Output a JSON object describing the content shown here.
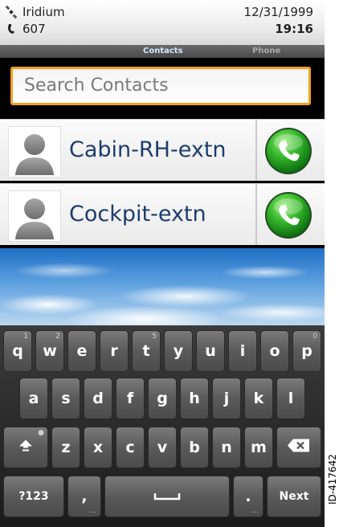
{
  "status_bar": {
    "carrier": "Iridium",
    "line_number": "607",
    "date": "12/31/1999",
    "time": "19:16",
    "icons": [
      "satellite-icon",
      "handset-icon"
    ]
  },
  "tabs": [
    {
      "label": "Contacts",
      "active": true
    },
    {
      "label": "Phone",
      "active": false
    }
  ],
  "search": {
    "placeholder": "Search Contacts",
    "value": ""
  },
  "contacts": [
    {
      "name": "Cabin-RH-extn"
    },
    {
      "name": "Cockpit-extn"
    }
  ],
  "keyboard": {
    "row1": [
      {
        "key": "q",
        "hint": "1"
      },
      {
        "key": "w",
        "hint": "2"
      },
      {
        "key": "e",
        "hint": ""
      },
      {
        "key": "r",
        "hint": ""
      },
      {
        "key": "t",
        "hint": "5"
      },
      {
        "key": "y",
        "hint": ""
      },
      {
        "key": "u",
        "hint": ""
      },
      {
        "key": "i",
        "hint": ""
      },
      {
        "key": "o",
        "hint": ""
      },
      {
        "key": "p",
        "hint": "0"
      }
    ],
    "row2": [
      "a",
      "s",
      "d",
      "f",
      "g",
      "h",
      "j",
      "k",
      "l"
    ],
    "row3": [
      "z",
      "x",
      "c",
      "v",
      "b",
      "n",
      "m"
    ],
    "symbols_label": "?123",
    "comma_label": ",",
    "period_label": ".",
    "next_label": "Next"
  },
  "side_label": "ID-417642",
  "colors": {
    "search_border": "#f5a020",
    "contact_name": "#1c3c6e",
    "call_button": "#2aa52a"
  }
}
